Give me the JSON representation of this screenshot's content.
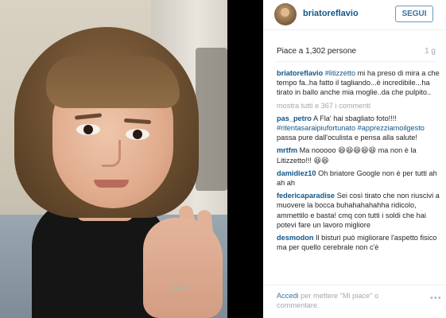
{
  "header": {
    "username": "briatoreflavio",
    "follow_label": "SEGUI"
  },
  "post": {
    "likes": "Piace a 1,302 persone",
    "time": "1 g"
  },
  "caption": {
    "user": "briatoreflavio",
    "hashtag": "#litizzetto",
    "text": " mi ha preso di mira a che tempo fa..ha fatto il tagliando...è incredibile...ha tirato in ballo anche mia moglie..da che pulpito.."
  },
  "show_all": "mostra tutti e 367 i commenti",
  "comments": [
    {
      "user": "pas_petro",
      "pre": " A Fla' hai sbagliato foto!!!! ",
      "tags": "#ritentasaraipiufortunato #apprezziamoilgesto",
      "post": " passa pure dall'oculista e pensa alla salute!"
    },
    {
      "user": "mrtfm",
      "pre": " Ma nooooo ",
      "emoji": "😆😆😆😆😆",
      "post": " ma non è la Litizzetto!!! ",
      "emoji2": "😆😆"
    },
    {
      "user": "damidiez10",
      "text": " Oh briatore Google non è per tutti ah ah ah"
    },
    {
      "user": "federicaparadise",
      "text": " Sei così tirato che non riuscivi a muovere la bocca buhahahahahha ridicolo, ammettilo e basta! cmq con tutti i soldi che hai potevi fare un lavoro migliore"
    },
    {
      "user": "desmodon",
      "text": " Il bisturi può migliorare l'aspetto fisico ma per quello cerebrale non c'è"
    }
  ],
  "footer": {
    "login_link": "Accedi",
    "login_text": " per mettere \"Mi piace\" o commentare.",
    "more_icon": "ellipsis-icon",
    "more_glyph": "•••"
  },
  "colors": {
    "link": "#125688",
    "button": "#3f729b",
    "muted": "#a5a7aa"
  }
}
